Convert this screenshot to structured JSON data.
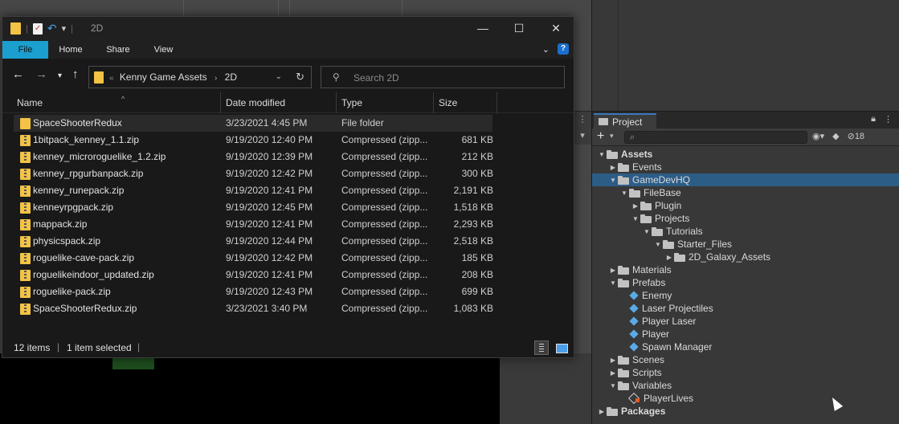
{
  "explorer": {
    "window_title": "2D",
    "ribbon_tabs": [
      "File",
      "Home",
      "Share",
      "View"
    ],
    "breadcrumb": {
      "overflow": "«",
      "items": [
        "Kenny Game Assets",
        "2D"
      ]
    },
    "search_placeholder": "Search 2D",
    "columns": [
      "Name",
      "Date modified",
      "Type",
      "Size"
    ],
    "files": [
      {
        "name": "SpaceShooterRedux",
        "date": "3/23/2021 4:45 PM",
        "type": "File folder",
        "size": "",
        "kind": "folder",
        "selected": true
      },
      {
        "name": "1bitpack_kenney_1.1.zip",
        "date": "9/19/2020 12:40 PM",
        "type": "Compressed (zipp...",
        "size": "681 KB",
        "kind": "zip"
      },
      {
        "name": "kenney_microroguelike_1.2.zip",
        "date": "9/19/2020 12:39 PM",
        "type": "Compressed (zipp...",
        "size": "212 KB",
        "kind": "zip"
      },
      {
        "name": "kenney_rpgurbanpack.zip",
        "date": "9/19/2020 12:42 PM",
        "type": "Compressed (zipp...",
        "size": "300 KB",
        "kind": "zip"
      },
      {
        "name": "kenney_runepack.zip",
        "date": "9/19/2020 12:41 PM",
        "type": "Compressed (zipp...",
        "size": "2,191 KB",
        "kind": "zip"
      },
      {
        "name": "kenneyrpgpack.zip",
        "date": "9/19/2020 12:45 PM",
        "type": "Compressed (zipp...",
        "size": "1,518 KB",
        "kind": "zip"
      },
      {
        "name": "mappack.zip",
        "date": "9/19/2020 12:41 PM",
        "type": "Compressed (zipp...",
        "size": "2,293 KB",
        "kind": "zip"
      },
      {
        "name": "physicspack.zip",
        "date": "9/19/2020 12:44 PM",
        "type": "Compressed (zipp...",
        "size": "2,518 KB",
        "kind": "zip"
      },
      {
        "name": "roguelike-cave-pack.zip",
        "date": "9/19/2020 12:42 PM",
        "type": "Compressed (zipp...",
        "size": "185 KB",
        "kind": "zip"
      },
      {
        "name": "roguelikeindoor_updated.zip",
        "date": "9/19/2020 12:41 PM",
        "type": "Compressed (zipp...",
        "size": "208 KB",
        "kind": "zip"
      },
      {
        "name": "roguelike-pack.zip",
        "date": "9/19/2020 12:43 PM",
        "type": "Compressed (zipp...",
        "size": "699 KB",
        "kind": "zip"
      },
      {
        "name": "SpaceShooterRedux.zip",
        "date": "3/23/2021 3:40 PM",
        "type": "Compressed (zipp...",
        "size": "1,083 KB",
        "kind": "zip"
      }
    ],
    "status_count": "12 items",
    "status_selected": "1 item selected",
    "accent_color": "#1a9fcf"
  },
  "unity_project": {
    "tab_label": "Project",
    "hidden_count": "18",
    "tree": [
      {
        "label": "Assets",
        "depth": 0,
        "arrow": "down",
        "icon": "folder",
        "bold": true
      },
      {
        "label": "Events",
        "depth": 1,
        "arrow": "right",
        "icon": "folder"
      },
      {
        "label": "GameDevHQ",
        "depth": 1,
        "arrow": "down",
        "icon": "folder",
        "selected": true
      },
      {
        "label": "FileBase",
        "depth": 2,
        "arrow": "down",
        "icon": "folder"
      },
      {
        "label": "Plugin",
        "depth": 3,
        "arrow": "right",
        "icon": "folder"
      },
      {
        "label": "Projects",
        "depth": 3,
        "arrow": "down",
        "icon": "folder"
      },
      {
        "label": "Tutorials",
        "depth": 4,
        "arrow": "down",
        "icon": "folder"
      },
      {
        "label": "Starter_Files",
        "depth": 5,
        "arrow": "down",
        "icon": "folder"
      },
      {
        "label": "2D_Galaxy_Assets",
        "depth": 6,
        "arrow": "right",
        "icon": "folder"
      },
      {
        "label": "Materials",
        "depth": 1,
        "arrow": "right",
        "icon": "folder"
      },
      {
        "label": "Prefabs",
        "depth": 1,
        "arrow": "down",
        "icon": "folder"
      },
      {
        "label": "Enemy",
        "depth": 2,
        "arrow": "",
        "icon": "prefab"
      },
      {
        "label": "Laser Projectiles",
        "depth": 2,
        "arrow": "",
        "icon": "prefab"
      },
      {
        "label": "Player Laser",
        "depth": 2,
        "arrow": "",
        "icon": "prefab"
      },
      {
        "label": "Player",
        "depth": 2,
        "arrow": "",
        "icon": "prefab"
      },
      {
        "label": "Spawn Manager",
        "depth": 2,
        "arrow": "",
        "icon": "prefab"
      },
      {
        "label": "Scenes",
        "depth": 1,
        "arrow": "right",
        "icon": "folder"
      },
      {
        "label": "Scripts",
        "depth": 1,
        "arrow": "right",
        "icon": "folder"
      },
      {
        "label": "Variables",
        "depth": 1,
        "arrow": "down",
        "icon": "folder"
      },
      {
        "label": "PlayerLives",
        "depth": 2,
        "arrow": "",
        "icon": "scriptable-object"
      },
      {
        "label": "Packages",
        "depth": 0,
        "arrow": "right",
        "icon": "folder",
        "bold": true
      }
    ],
    "selection_color": "#2c5d87"
  }
}
